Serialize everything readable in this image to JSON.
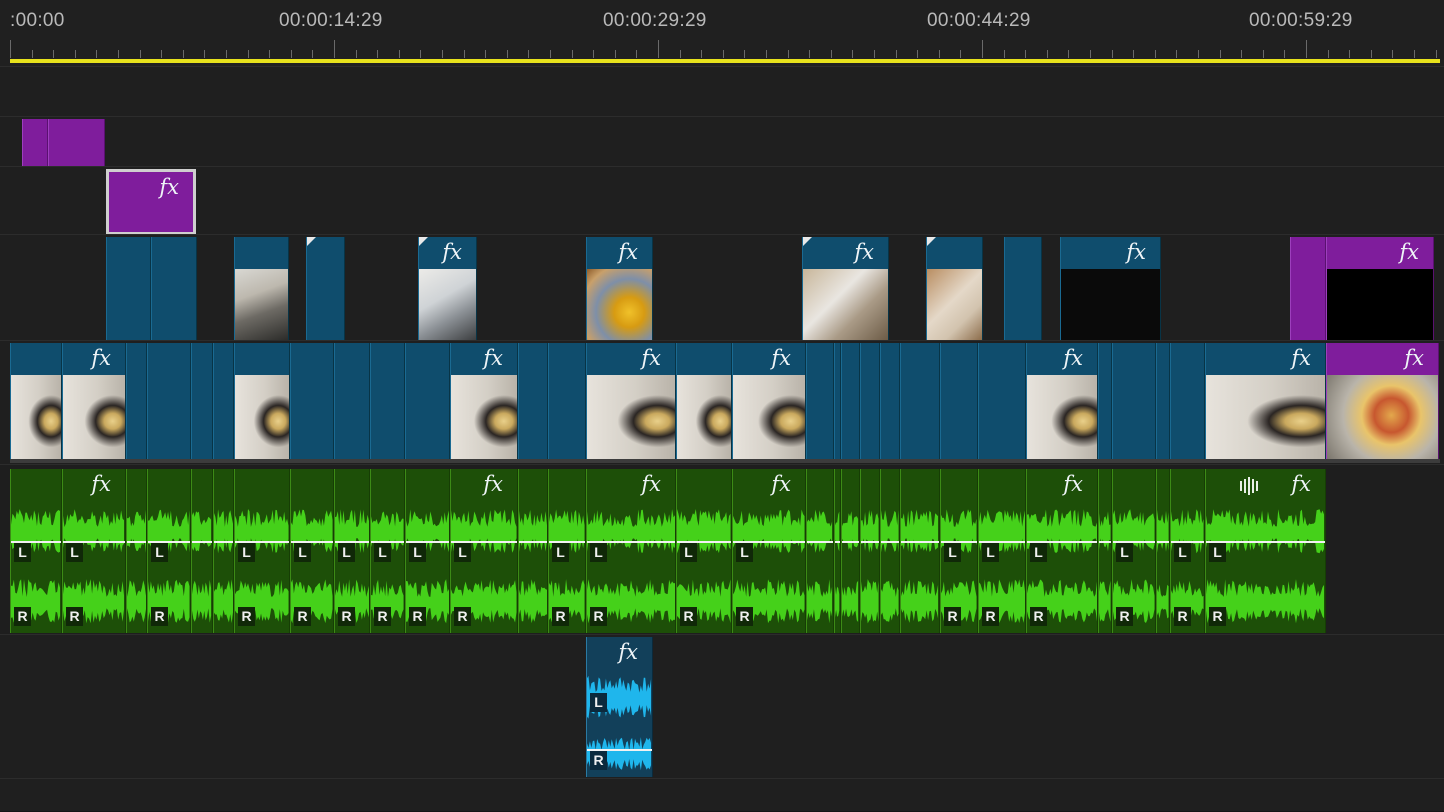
{
  "ruler": {
    "timecodes": [
      ":00:00",
      "00:00:14:29",
      "00:00:29:29",
      "00:00:44:29",
      "00:00:59:29"
    ]
  },
  "clip_labels": {
    "fx": "fx",
    "left_channel": "L",
    "right_channel": "R"
  },
  "colors": {
    "playhead_bar": "#e8e21c",
    "video_clip": "#0f4d6d",
    "graphics_clip": "#7f1d9c",
    "audio_clip": "#1d4f08",
    "audio_waveform": "#45d11a",
    "secondary_audio_clip": "#12405a",
    "secondary_waveform": "#1fb6ec"
  },
  "icons": {
    "fx_badge": "fx-icon",
    "audio_waveform_badge": "waveform-icon",
    "transition_marker": "corner-marker-icon"
  }
}
